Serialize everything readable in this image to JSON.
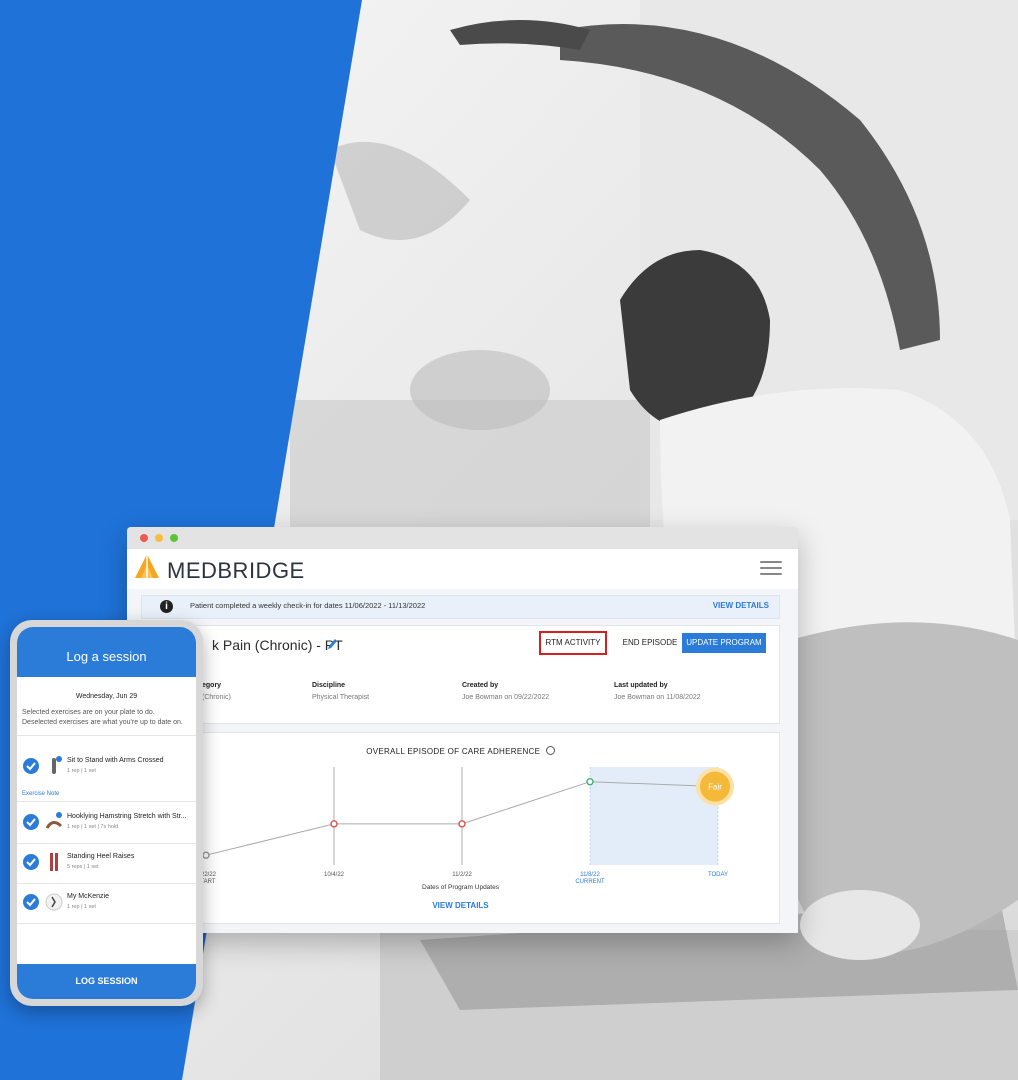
{
  "colors": {
    "brand_blue": "#1f72d8",
    "accent_blue": "#2b7bd9",
    "highlight_red": "#d42020",
    "fair_badge": "#f5b93a"
  },
  "desktop": {
    "brand": "MEDBRIDGE",
    "notice": {
      "text": "Patient completed a weekly check-in for dates 11/06/2022 - 11/13/2022",
      "action": "VIEW DETAILS"
    },
    "episode": {
      "title": "k Pain (Chronic) - PT",
      "buttons": {
        "rtm": "RTM ACTIVITY",
        "end": "END EPISODE",
        "update": "UPDATE PROGRAM"
      },
      "meta": [
        {
          "label": "egory",
          "value": "(Chronic)"
        },
        {
          "label": "Discipline",
          "value": "Physical Therapist"
        },
        {
          "label": "Created by",
          "value": "Joe Bowman on 09/22/2022"
        },
        {
          "label": "Last updated by",
          "value": "Joe Bowman on 11/08/2022"
        }
      ]
    },
    "adherence": {
      "title": "OVERALL EPISODE OF CARE ADHERENCE",
      "xlabel": "Dates of Program Updates",
      "action": "VIEW DETAILS",
      "badge": "Fair"
    }
  },
  "chart_data": {
    "type": "line",
    "title": "OVERALL EPISODE OF CARE ADHERENCE",
    "xlabel": "Dates of Program Updates",
    "categories": [
      "9/22/22",
      "10/4/22",
      "11/2/22",
      "11/8/22",
      "TODAY"
    ],
    "tick_sublabels": [
      "START",
      "",
      "",
      "CURRENT",
      ""
    ],
    "values": [
      0.1,
      0.42,
      0.42,
      0.85,
      0.8
    ],
    "point_colors": [
      "#999999",
      "#d9534f",
      "#d9534f",
      "#3bb26b",
      "#f5b93a"
    ],
    "highlight_range": [
      "11/8/22",
      "TODAY"
    ],
    "badge": "Fair"
  },
  "phone": {
    "header": "Log a session",
    "date": "Wednesday, Jun 29",
    "description": "Selected exercises are on your plate to do. Deselected exercises are what you're up to date on.",
    "exercise_note": "Exercise Note",
    "exercises": [
      {
        "name": "Sit to Stand with Arms Crossed",
        "detail": "1 rep | 1 set"
      },
      {
        "name": "Hooklying Hamstring Stretch with Str...",
        "detail": "1 rep | 1 set | 7s hold"
      },
      {
        "name": "Standing Heel Raises",
        "detail": "5 reps | 1 set"
      },
      {
        "name": "My McKenzie",
        "detail": "1 rep | 1 set"
      }
    ],
    "button": "LOG SESSION"
  }
}
